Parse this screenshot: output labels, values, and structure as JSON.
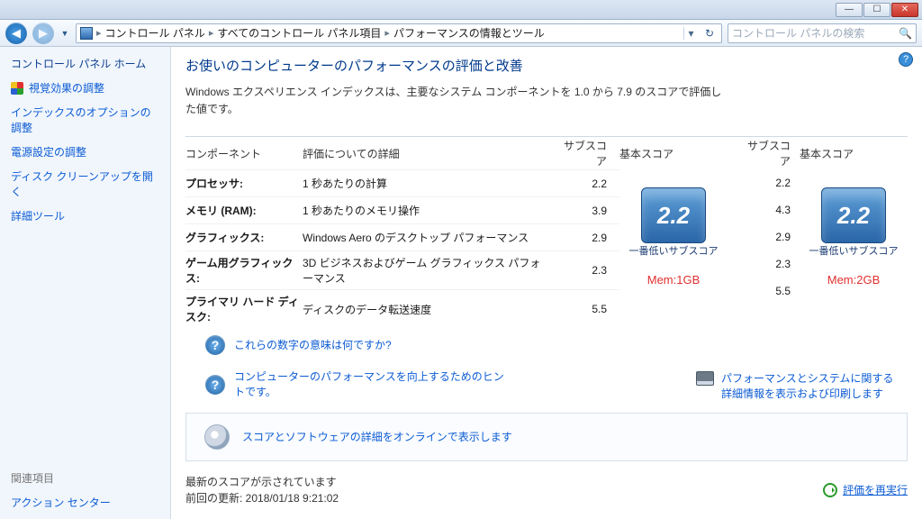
{
  "window": {
    "minimize": "—",
    "maximize": "☐",
    "close": "✕"
  },
  "toolbar": {
    "back": "◀",
    "forward": "▶",
    "dropdown": "▼",
    "breadcrumb": {
      "sep": "▸",
      "item1": "コントロール パネル",
      "item2": "すべてのコントロール パネル項目",
      "item3": "パフォーマンスの情報とツール"
    },
    "bcdrop": "▾",
    "refresh": "↻",
    "search_placeholder": "コントロール パネルの検索",
    "search_icon": "🔍"
  },
  "sidebar": {
    "home": "コントロール パネル ホーム",
    "links": {
      "visual": "視覚効果の調整",
      "index": "インデックスのオプションの調整",
      "power": "電源設定の調整",
      "disk": "ディスク クリーンアップを開く",
      "advanced": "詳細ツール"
    },
    "related_title": "関連項目",
    "related_link": "アクション センター"
  },
  "main": {
    "help": "?",
    "title": "お使いのコンピューターのパフォーマンスの評価と改善",
    "subdesc": "Windows エクスペリエンス インデックスは、主要なシステム コンポーネントを 1.0 から 7.9 のスコアで評価した値です。",
    "headers": {
      "component": "コンポーネント",
      "detail": "評価についての詳細",
      "subscore": "サブスコア",
      "basescore": "基本スコア"
    },
    "rows": [
      {
        "comp": "プロセッサ:",
        "desc": "1 秒あたりの計算",
        "sub1": "2.2",
        "sub2": "2.2"
      },
      {
        "comp": "メモリ (RAM):",
        "desc": "1 秒あたりのメモリ操作",
        "sub1": "3.9",
        "sub2": "4.3"
      },
      {
        "comp": "グラフィックス:",
        "desc": "Windows Aero のデスクトップ パフォーマンス",
        "sub1": "2.9",
        "sub2": "2.9"
      },
      {
        "comp": "ゲーム用グラフィックス:",
        "desc": "3D ビジネスおよびゲーム グラフィックス パフォーマンス",
        "sub1": "2.3",
        "sub2": "2.3"
      },
      {
        "comp": "プライマリ ハード ディスク:",
        "desc": "ディスクのデータ転送速度",
        "sub1": "5.5",
        "sub2": "5.5"
      }
    ],
    "badge1": "2.2",
    "badge2": "2.2",
    "badge_caption": "一番低いサブスコア",
    "mem1": "Mem:1GB",
    "mem2": "Mem:2GB",
    "q1": "これらの数字の意味は何ですか?",
    "q2": "コンピューターのパフォーマンスを向上するためのヒントです。",
    "soft": "スコアとソフトウェアの詳細をオンラインで表示します",
    "print": "パフォーマンスとシステムに関する詳細情報を表示および印刷します",
    "status_line1": "最新のスコアが示されています",
    "status_line2": "前回の更新: 2018/01/18 9:21:02",
    "rerun": "評価を再実行"
  }
}
